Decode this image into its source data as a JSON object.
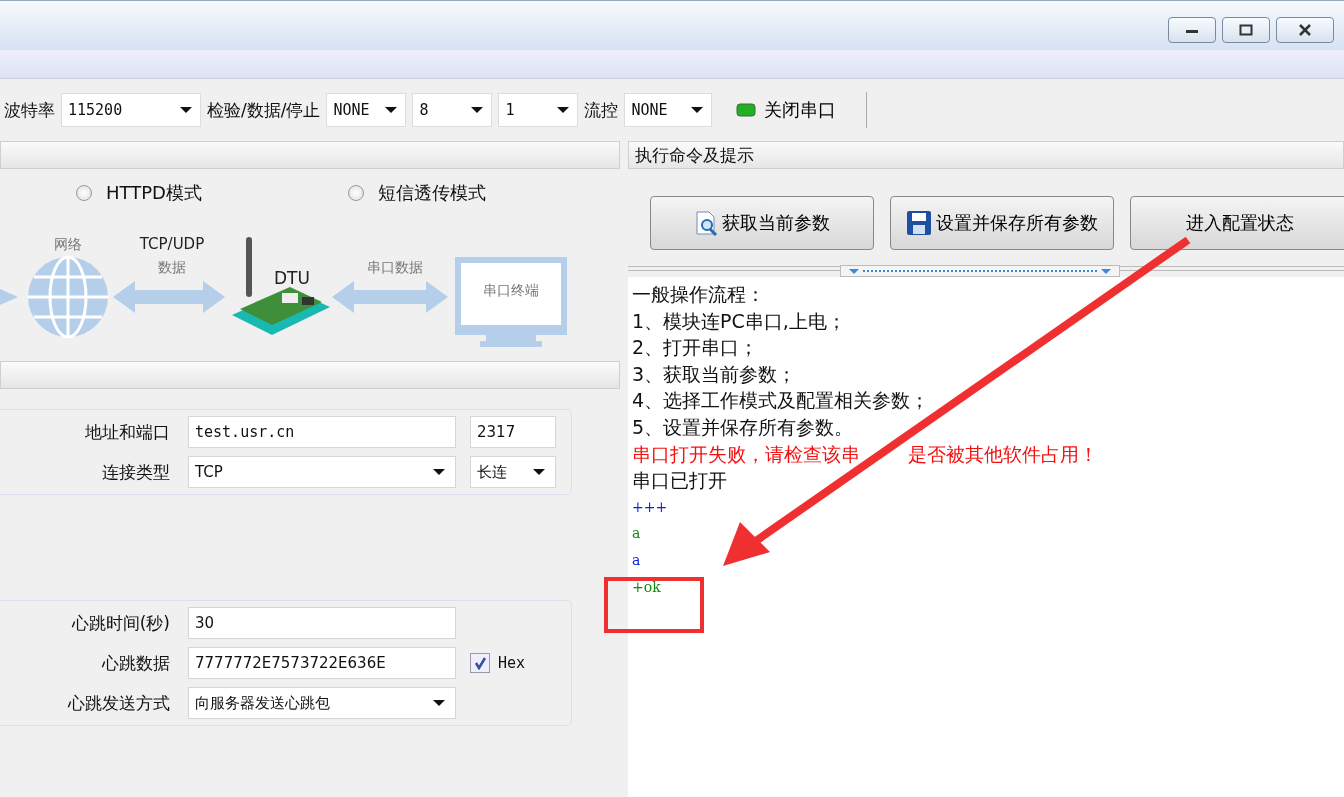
{
  "toolbar": {
    "baud_label": "波特率",
    "baud": "115200",
    "parity_label": "检验/数据/停止",
    "parity": "NONE",
    "data_bits": "8",
    "stop_bits": "1",
    "flow_label": "流控",
    "flow": "NONE",
    "port_on": true,
    "port_button": "关闭串口"
  },
  "left": {
    "modes": [
      {
        "label": "HTTPD模式",
        "selected": false
      },
      {
        "label": "短信透传模式",
        "selected": false
      }
    ],
    "diagram": {
      "network": "网络",
      "link1": "TCP/UDP",
      "link1_sub": "数据",
      "device": "DTU",
      "link2": "串口数据",
      "terminal": "串口终端"
    },
    "server": [
      {
        "label": "地址和端口",
        "value": "test.usr.cn",
        "extra": "2317",
        "kind": "field"
      },
      {
        "label": "连接类型",
        "value": "TCP",
        "extra": "长连",
        "kind": "select"
      }
    ],
    "heartbeat": [
      {
        "label": "心跳时间(秒)",
        "value": "30",
        "kind": "field"
      },
      {
        "label": "心跳数据",
        "value": "7777772E7573722E636E",
        "kind": "field",
        "hex": {
          "label": "Hex",
          "checked": true
        }
      },
      {
        "label": "心跳发送方式",
        "value": "向服务器发送心跳包",
        "kind": "select"
      }
    ]
  },
  "right": {
    "title": "执行命令及提示",
    "buttons": [
      {
        "label": "获取当前参数"
      },
      {
        "label": "设置并保存所有参数"
      },
      {
        "label": "进入配置状态"
      }
    ],
    "log": [
      {
        "text": "一般操作流程：",
        "kind": "info"
      },
      {
        "text": "1、模块连PC串口,上电；",
        "kind": "info"
      },
      {
        "text": "2、打开串口；",
        "kind": "info"
      },
      {
        "text": "3、获取当前参数；",
        "kind": "info"
      },
      {
        "text": "4、选择工作模式及配置相关参数；",
        "kind": "info"
      },
      {
        "text": "5、设置并保存所有参数。",
        "kind": "info"
      },
      {
        "text": "串口打开失败，请检查该串",
        "text_after_gap": "是否被其他软件占用！",
        "kind": "error"
      },
      {
        "text": "串口已打开",
        "kind": "info"
      },
      {
        "text": "+++",
        "kind": "sent"
      },
      {
        "text": "a",
        "kind": "received"
      },
      {
        "text": "a",
        "kind": "sent"
      },
      {
        "text": "+ok",
        "kind": "received"
      }
    ]
  }
}
